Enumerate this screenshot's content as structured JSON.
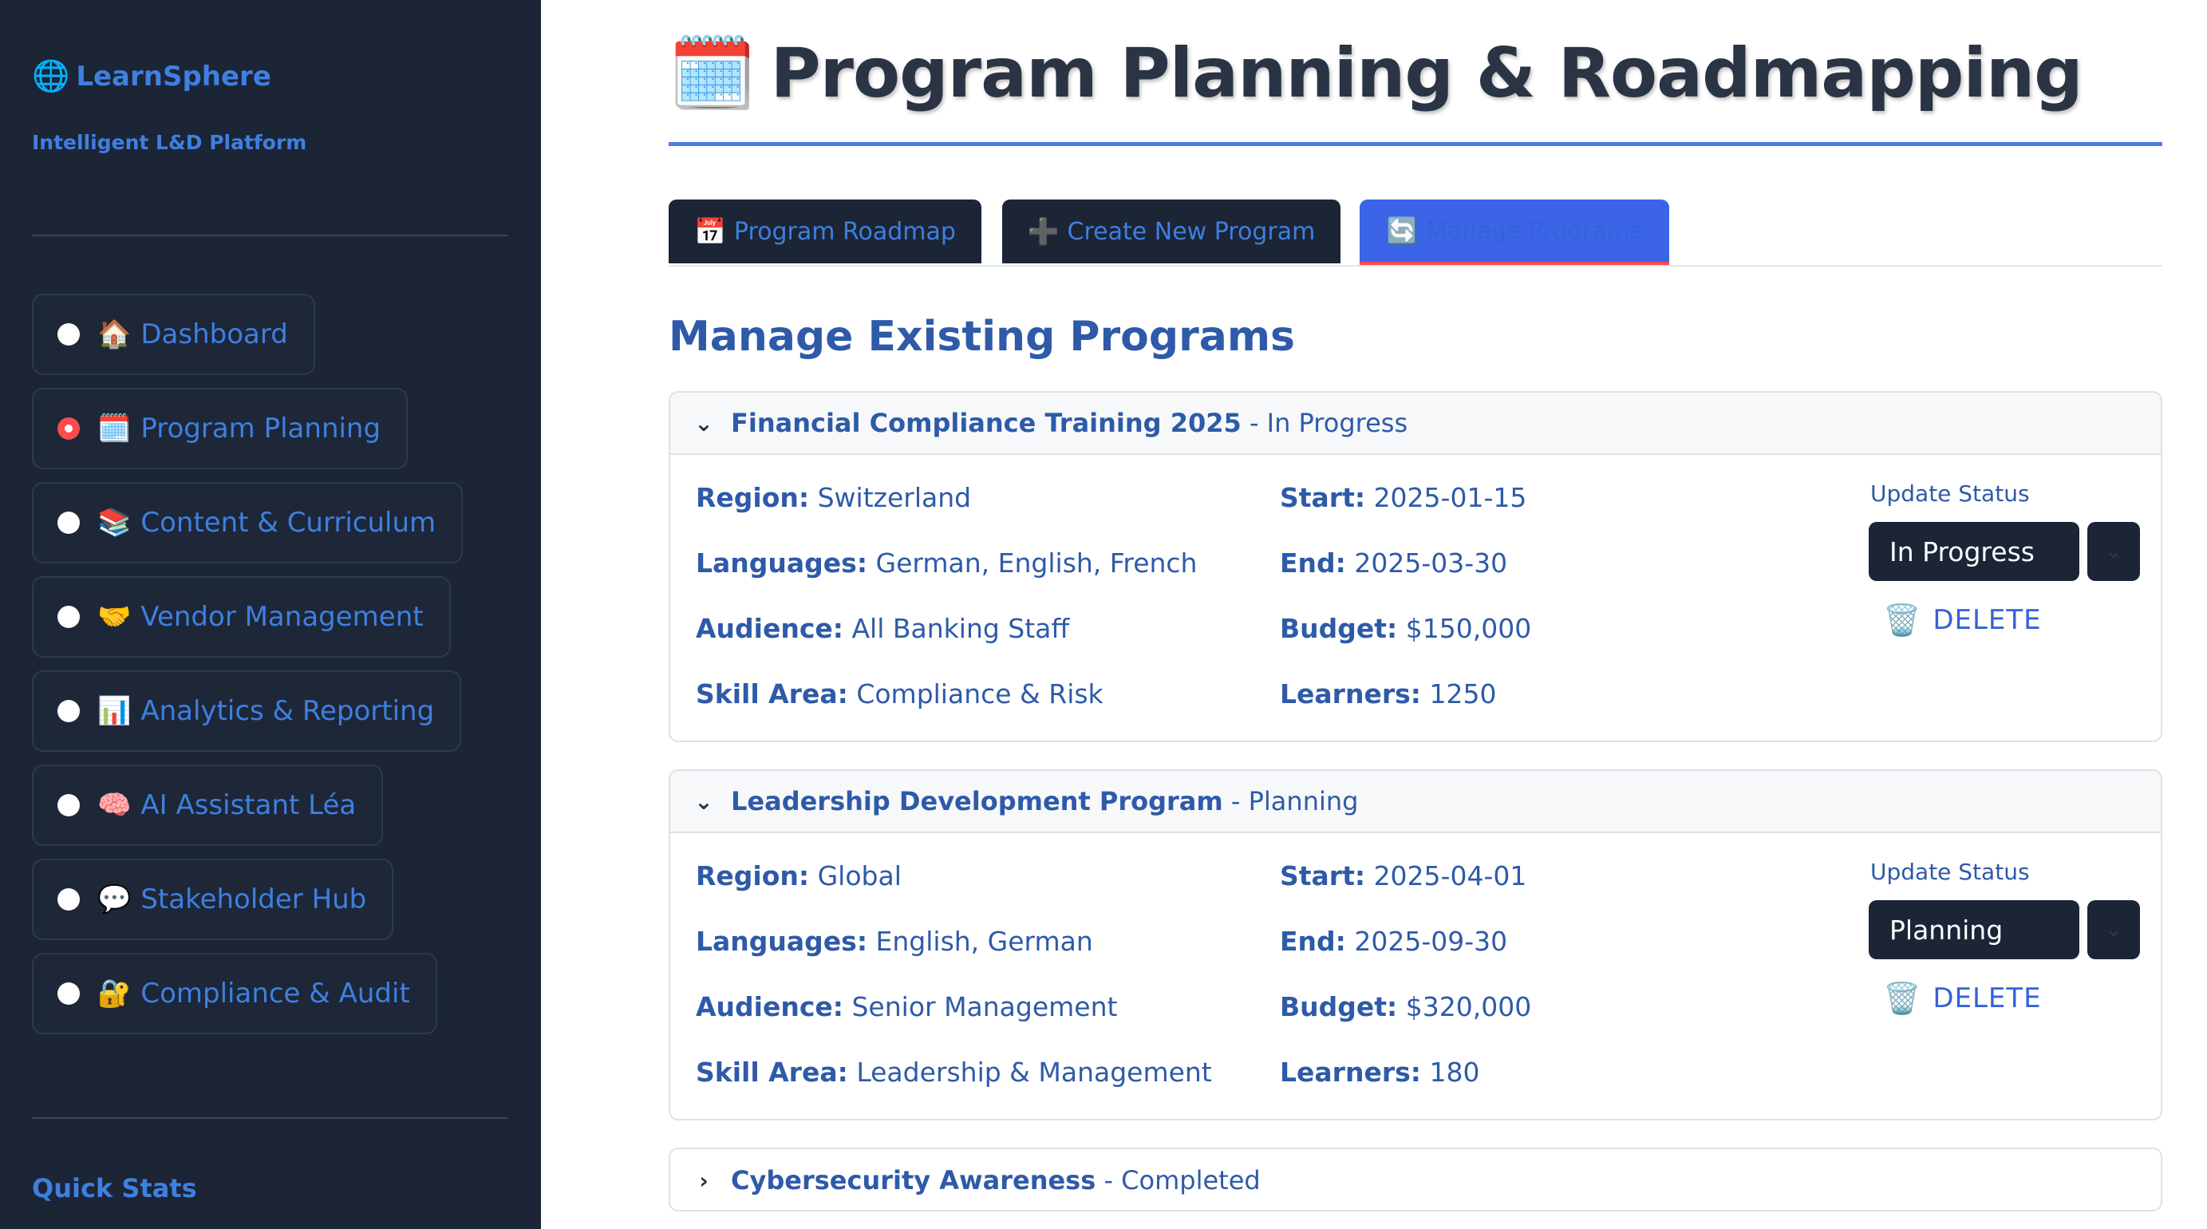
{
  "sidebar": {
    "brand": {
      "icon": "🌐",
      "name": "LearnSphere",
      "tagline": "Intelligent L&D Platform"
    },
    "items": [
      {
        "icon": "🏠",
        "label": "Dashboard",
        "selected": false
      },
      {
        "icon": "🗓️",
        "label": "Program Planning",
        "selected": true
      },
      {
        "icon": "📚",
        "label": "Content & Curriculum",
        "selected": false
      },
      {
        "icon": "🤝",
        "label": "Vendor Management",
        "selected": false
      },
      {
        "icon": "📊",
        "label": "Analytics & Reporting",
        "selected": false
      },
      {
        "icon": "🧠",
        "label": "AI Assistant Léa",
        "selected": false
      },
      {
        "icon": "💬",
        "label": "Stakeholder Hub",
        "selected": false
      },
      {
        "icon": "🔐",
        "label": "Compliance & Audit",
        "selected": false
      }
    ],
    "quick_stats_title": "Quick Stats"
  },
  "header": {
    "icon": "🗓️",
    "title": "Program Planning & Roadmapping"
  },
  "tabs": [
    {
      "icon": "📅",
      "label": "Program Roadmap",
      "active": false
    },
    {
      "icon": "➕",
      "label": "Create New Program",
      "active": false
    },
    {
      "icon": "🔄",
      "label": "Manage Programs",
      "active": true
    }
  ],
  "section_title": "Manage Existing Programs",
  "labels": {
    "region": "Region:",
    "languages": "Languages:",
    "audience": "Audience:",
    "skill_area": "Skill Area:",
    "start": "Start:",
    "end": "End:",
    "budget": "Budget:",
    "learners": "Learners:",
    "update_status": "Update Status",
    "delete": "DELETE",
    "separator": " - "
  },
  "programs": [
    {
      "name": "Financial Compliance Training 2025",
      "status": "In Progress",
      "expanded": true,
      "region": "Switzerland",
      "languages": "German, English, French",
      "audience": "All Banking Staff",
      "skill_area": "Compliance & Risk",
      "start": "2025-01-15",
      "end": "2025-03-30",
      "budget": "$150,000",
      "learners": "1250"
    },
    {
      "name": "Leadership Development Program",
      "status": "Planning",
      "expanded": true,
      "region": "Global",
      "languages": "English, German",
      "audience": "Senior Management",
      "skill_area": "Leadership & Management",
      "start": "2025-04-01",
      "end": "2025-09-30",
      "budget": "$320,000",
      "learners": "180"
    },
    {
      "name": "Cybersecurity Awareness",
      "status": "Completed",
      "expanded": false
    }
  ],
  "colors": {
    "sidebar_bg": "#1b2536",
    "accent": "#3f7fe0",
    "active_tab": "#3b64e8",
    "active_indicator": "#ff4b4b",
    "text_blue": "#2e5aa8"
  },
  "icons": {
    "chevron_open": "⌄",
    "chevron_closed": "›",
    "trash": "🗑️",
    "select_arrow": "⌄"
  }
}
